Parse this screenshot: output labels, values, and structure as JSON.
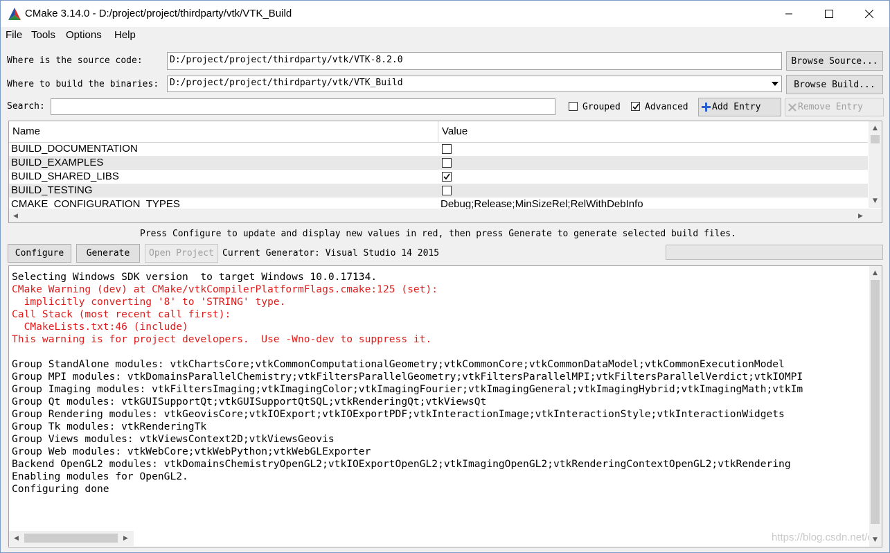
{
  "window": {
    "title": "CMake 3.14.0 - D:/project/project/thirdparty/vtk/VTK_Build",
    "minimize_glyph": "—",
    "maximize_glyph": "☐",
    "close_glyph": "✕"
  },
  "menu": [
    "File",
    "Tools",
    "Options",
    "Help"
  ],
  "source": {
    "label": "Where is the source code:",
    "value": "D:/project/project/thirdparty/vtk/VTK-8.2.0",
    "button": "Browse Source..."
  },
  "build": {
    "label": "Where to build the binaries:",
    "value": "D:/project/project/thirdparty/vtk/VTK_Build",
    "button": "Browse Build..."
  },
  "search": {
    "label": "Search:",
    "value": ""
  },
  "options": {
    "grouped_label": "Grouped",
    "grouped_checked": false,
    "advanced_label": "Advanced",
    "advanced_checked": true,
    "add_entry": "Add Entry",
    "remove_entry": "Remove Entry"
  },
  "table": {
    "col_name": "Name",
    "col_value": "Value",
    "rows": [
      {
        "name": "BUILD_DOCUMENTATION",
        "type": "bool",
        "checked": false
      },
      {
        "name": "BUILD_EXAMPLES",
        "type": "bool",
        "checked": false
      },
      {
        "name": "BUILD_SHARED_LIBS",
        "type": "bool",
        "checked": true
      },
      {
        "name": "BUILD_TESTING",
        "type": "bool",
        "checked": false
      },
      {
        "name": "CMAKE_CONFIGURATION_TYPES",
        "type": "text",
        "value": "Debug;Release;MinSizeRel;RelWithDebInfo"
      }
    ]
  },
  "hint": "Press Configure to update and display new values in red, then press Generate to generate selected build files.",
  "actions": {
    "configure": "Configure",
    "generate": "Generate",
    "open_project": "Open Project",
    "generator_text": "Current Generator: Visual Studio 14 2015"
  },
  "output": [
    {
      "text": "Selecting Windows SDK version  to target Windows 10.0.17134.",
      "color": "black"
    },
    {
      "text": "CMake Warning (dev) at CMake/vtkCompilerPlatformFlags.cmake:125 (set):",
      "color": "red"
    },
    {
      "text": "  implicitly converting '8' to 'STRING' type.",
      "color": "red"
    },
    {
      "text": "Call Stack (most recent call first):",
      "color": "red"
    },
    {
      "text": "  CMakeLists.txt:46 (include)",
      "color": "red"
    },
    {
      "text": "This warning is for project developers.  Use -Wno-dev to suppress it.",
      "color": "red"
    },
    {
      "text": "",
      "color": "black"
    },
    {
      "text": "Group StandAlone modules: vtkChartsCore;vtkCommonComputationalGeometry;vtkCommonCore;vtkCommonDataModel;vtkCommonExecutionModel",
      "color": "black"
    },
    {
      "text": "Group MPI modules: vtkDomainsParallelChemistry;vtkFiltersParallelGeometry;vtkFiltersParallelMPI;vtkFiltersParallelVerdict;vtkIOMPI",
      "color": "black"
    },
    {
      "text": "Group Imaging modules: vtkFiltersImaging;vtkImagingColor;vtkImagingFourier;vtkImagingGeneral;vtkImagingHybrid;vtkImagingMath;vtkIm",
      "color": "black"
    },
    {
      "text": "Group Qt modules: vtkGUISupportQt;vtkGUISupportQtSQL;vtkRenderingQt;vtkViewsQt",
      "color": "black"
    },
    {
      "text": "Group Rendering modules: vtkGeovisCore;vtkIOExport;vtkIOExportPDF;vtkInteractionImage;vtkInteractionStyle;vtkInteractionWidgets",
      "color": "black"
    },
    {
      "text": "Group Tk modules: vtkRenderingTk",
      "color": "black"
    },
    {
      "text": "Group Views modules: vtkViewsContext2D;vtkViewsGeovis",
      "color": "black"
    },
    {
      "text": "Group Web modules: vtkWebCore;vtkWebPython;vtkWebGLExporter",
      "color": "black"
    },
    {
      "text": "Backend OpenGL2 modules: vtkDomainsChemistryOpenGL2;vtkIOExportOpenGL2;vtkImagingOpenGL2;vtkRenderingContextOpenGL2;vtkRendering",
      "color": "black"
    },
    {
      "text": "Enabling modules for OpenGL2.",
      "color": "black"
    },
    {
      "text": "Configuring done",
      "color": "black"
    }
  ],
  "watermark": "https://blog.csdn.net/charce",
  "colors": {
    "warning_red": "#e01b1b",
    "title_bar": "#ffffff",
    "window_bg": "#f0f0f0"
  }
}
